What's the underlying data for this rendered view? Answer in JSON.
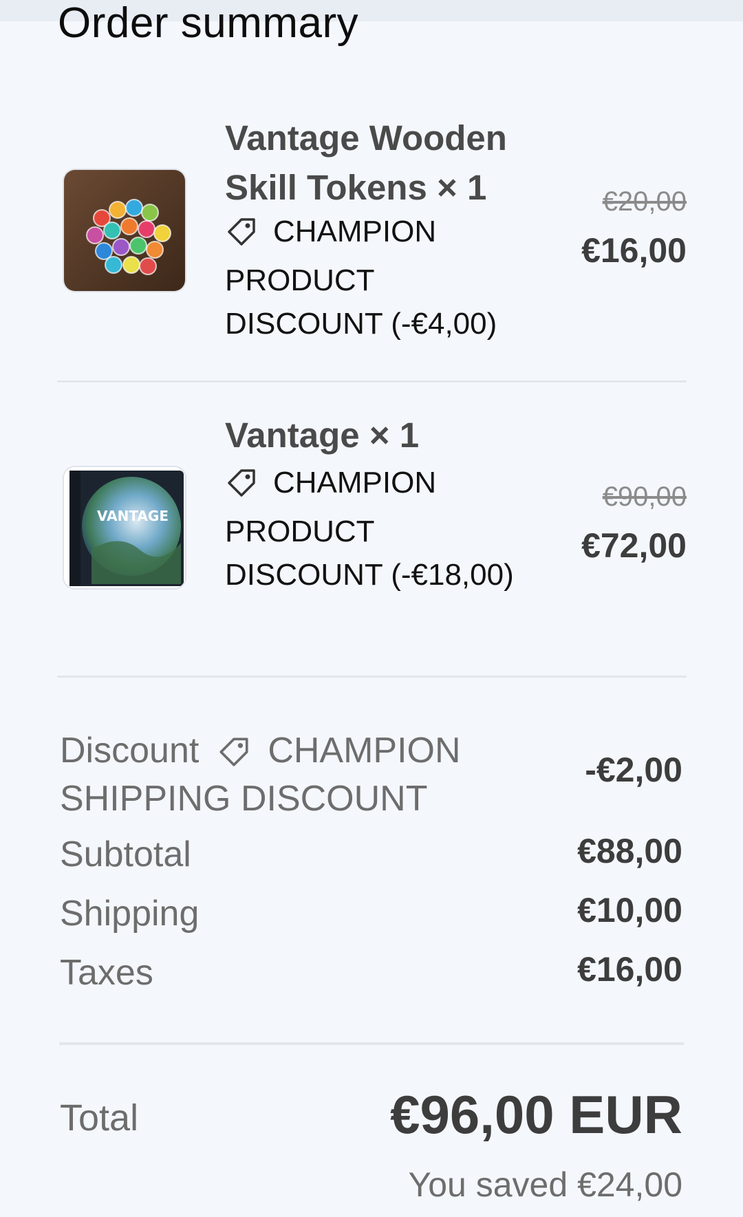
{
  "page": {
    "title": "Order summary"
  },
  "items": [
    {
      "name": "Vantage Wooden Skill Tokens × 1",
      "discount": "CHAMPION PRODUCT DISCOUNT (-€4,00)",
      "price_old": "€20,00",
      "price_new": "€16,00",
      "image_icon": "skill-tokens-image"
    },
    {
      "name": "Vantage × 1",
      "discount": "CHAMPION PRODUCT DISCOUNT (-€18,00)",
      "price_old": "€90,00",
      "price_new": "€72,00",
      "image_icon": "vantage-box-image",
      "box_title": "VANTAGE"
    }
  ],
  "summary": {
    "discount_label": "Discount",
    "discount_code": "CHAMPION SHIPPING DISCOUNT",
    "discount_value": "-€2,00",
    "subtotal_label": "Subtotal",
    "subtotal_value": "€88,00",
    "shipping_label": "Shipping",
    "shipping_value": "€10,00",
    "taxes_label": "Taxes",
    "taxes_value": "€16,00"
  },
  "total": {
    "label": "Total",
    "value": "€96,00 EUR",
    "saved": "You saved €24,00"
  },
  "colors": {
    "background": "#f4f7fc",
    "divider": "#e3e6eb",
    "muted_text": "#6d6d6d",
    "price_text": "#3d3d3d"
  }
}
